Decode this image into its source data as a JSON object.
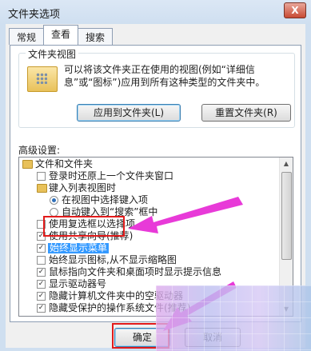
{
  "window": {
    "title": "文件夹选项",
    "close_glyph": "X"
  },
  "tabs": [
    {
      "label": "常规",
      "active": false
    },
    {
      "label": "查看",
      "active": true
    },
    {
      "label": "搜索",
      "active": false
    }
  ],
  "folder_views": {
    "legend": "文件夹视图",
    "description": "可以将该文件夹正在使用的视图(例如“详细信息”或“图标”)应用到所有这种类型的文件夹中。",
    "apply_button": "应用到文件夹(L)",
    "reset_button": "重置文件夹(R)"
  },
  "advanced": {
    "label": "高级设置:",
    "items": [
      {
        "type": "folder",
        "text": "文件和文件夹"
      },
      {
        "type": "checkbox",
        "checked": false,
        "text": "登录时还原上一个文件夹窗口"
      },
      {
        "type": "folder",
        "text": "键入列表视图时"
      },
      {
        "type": "radio",
        "checked": true,
        "text": "在视图中选择键入项"
      },
      {
        "type": "radio",
        "checked": false,
        "text": "自动键入到“搜索”框中"
      },
      {
        "type": "checkbox",
        "checked": false,
        "text": "使用复选框以选择项"
      },
      {
        "type": "checkbox",
        "checked": true,
        "text": "使用共享向导(推荐)"
      },
      {
        "type": "checkbox",
        "checked": true,
        "text": "始终显示菜单",
        "highlighted": true
      },
      {
        "type": "checkbox",
        "checked": false,
        "text": "始终显示图标,从不显示缩略图"
      },
      {
        "type": "checkbox",
        "checked": true,
        "text": "鼠标指向文件夹和桌面项时显示提示信息"
      },
      {
        "type": "checkbox",
        "checked": true,
        "text": "显示驱动器号"
      },
      {
        "type": "checkbox",
        "checked": true,
        "text": "隐藏计算机文件夹中的空驱动器"
      },
      {
        "type": "checkbox",
        "checked": true,
        "text": "隐藏受保护的操作系统文件(推荐)"
      }
    ]
  },
  "footer": {
    "ok_button": "确定",
    "cancel_button": "取消"
  },
  "colors": {
    "annotation": "#e21b1b",
    "arrow": "#e83ad8",
    "selection": "#3399ff"
  }
}
